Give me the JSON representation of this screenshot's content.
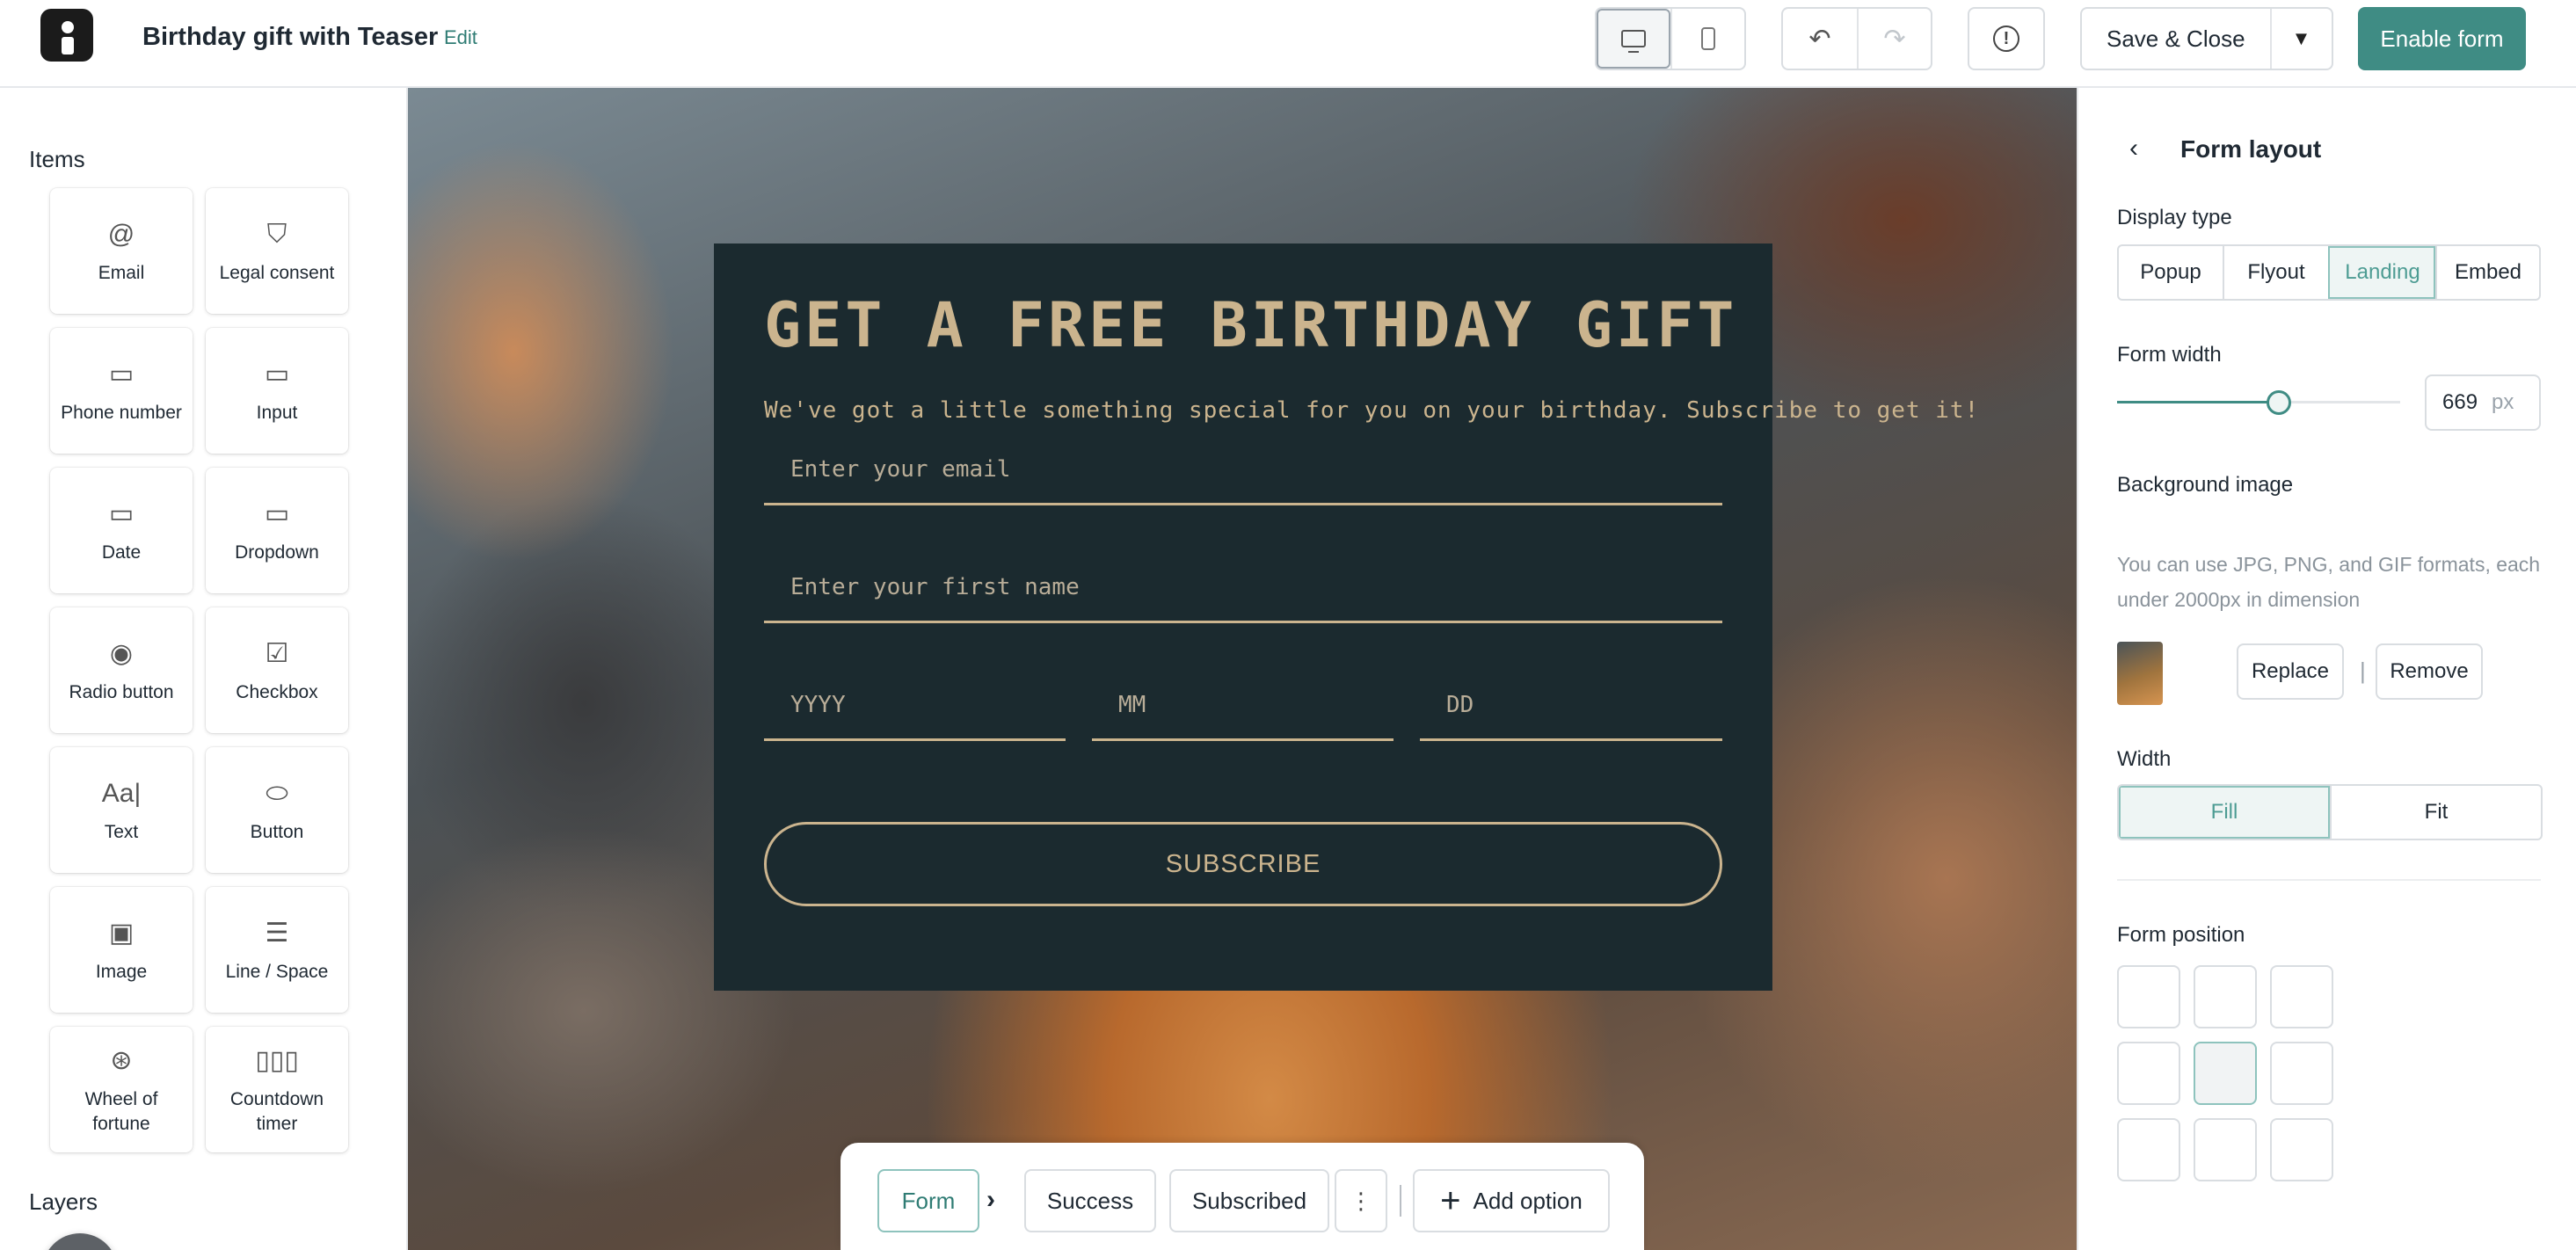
{
  "header": {
    "title": "Birthday gift with Teaser",
    "edit_label": "Edit",
    "save_label": "Save & Close",
    "enable_label": "Enable form",
    "device_active": "desktop"
  },
  "icons": {
    "logo": "brand-logo-icon",
    "undo": "undo-icon",
    "redo": "redo-icon",
    "alert": "alert-circle-icon",
    "chevron": "chevron-down-icon"
  },
  "sidebar": {
    "items_heading": "Items",
    "layers_heading": "Layers",
    "items": [
      {
        "label": "Email",
        "icon": "@",
        "name": "email"
      },
      {
        "label": "Legal consent",
        "icon": "⛉",
        "name": "legal-consent"
      },
      {
        "label": "Phone number",
        "icon": "▭",
        "name": "phone-number"
      },
      {
        "label": "Input",
        "icon": "▭",
        "name": "input"
      },
      {
        "label": "Date",
        "icon": "▭",
        "name": "date"
      },
      {
        "label": "Dropdown",
        "icon": "▭",
        "name": "dropdown"
      },
      {
        "label": "Radio button",
        "icon": "◉",
        "name": "radio-button"
      },
      {
        "label": "Checkbox",
        "icon": "☑",
        "name": "checkbox"
      },
      {
        "label": "Text",
        "icon": "Aa|",
        "name": "text"
      },
      {
        "label": "Button",
        "icon": "⬭",
        "name": "button"
      },
      {
        "label": "Image",
        "icon": "▣",
        "name": "image"
      },
      {
        "label": "Line / Space",
        "icon": "☰",
        "name": "line-space"
      },
      {
        "label": "Wheel of fortune",
        "icon": "⊛",
        "name": "wheel-of-fortune"
      },
      {
        "label": "Countdown timer",
        "icon": "▯▯▯",
        "name": "countdown-timer"
      }
    ]
  },
  "form": {
    "title": "GET A FREE BIRTHDAY GIFT",
    "subtitle": "We've got a little something special for you on your birthday. Subscribe to get it!",
    "email_placeholder": "Enter your email",
    "first_name_placeholder": "Enter your first name",
    "year_placeholder": "YYYY",
    "month_placeholder": "MM",
    "day_placeholder": "DD",
    "submit_label": "SUBSCRIBE",
    "colors": {
      "background": "#1b2a2f",
      "accent": "#cbb48e"
    }
  },
  "steps": {
    "items": [
      "Form",
      "Success",
      "Subscribed"
    ],
    "active": "Form",
    "add_option_label": "Add option"
  },
  "panel": {
    "title": "Form layout",
    "display_type_label": "Display type",
    "display_types": [
      "Popup",
      "Flyout",
      "Landing",
      "Embed"
    ],
    "display_type_selected": "Landing",
    "form_width_label": "Form width",
    "form_width_value": "669",
    "form_width_unit": "px",
    "form_width_fraction": 0.57,
    "background_image_label": "Background image",
    "background_image_help": "You can use JPG, PNG, and GIF formats, each under 2000px in dimension",
    "replace_label": "Replace",
    "remove_label": "Remove",
    "separator": "|",
    "width_label": "Width",
    "width_options": [
      "Fill",
      "Fit"
    ],
    "width_selected": "Fill",
    "form_position_label": "Form position",
    "form_position_selected": "middle-center"
  },
  "theme": {
    "accent": "#3f8c84",
    "accent_light": "#8ec3bd"
  }
}
